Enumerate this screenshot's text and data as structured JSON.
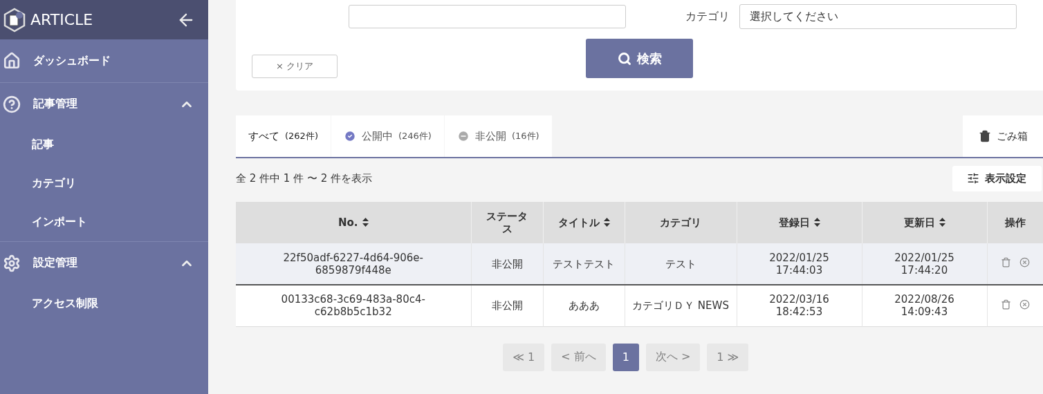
{
  "sidebar": {
    "brand": "ARTICLE",
    "items": [
      {
        "kind": "link",
        "label": "ダッシュボード"
      },
      {
        "kind": "group",
        "label": "記事管理",
        "expanded": true,
        "children": [
          {
            "label": "記事"
          },
          {
            "label": "カテゴリ"
          },
          {
            "label": "インポート"
          }
        ]
      },
      {
        "kind": "group",
        "label": "設定管理",
        "expanded": true,
        "children": [
          {
            "label": "アクセス制限"
          }
        ]
      }
    ]
  },
  "search_panel": {
    "category_label": "カテゴリ",
    "category_placeholder": "選択してください",
    "clear_button": "× クリア",
    "search_button": "検索"
  },
  "tabs": [
    {
      "label": "すべて",
      "count": "(262件)",
      "selected": true
    },
    {
      "label": "公開中",
      "count": "(246件)",
      "selected": false
    },
    {
      "label": "非公開",
      "count": "(16件)",
      "selected": false
    }
  ],
  "trash_button": "ごみ箱",
  "result_summary": "全 2 件中 1 件 〜 2 件を表示",
  "display_settings_button": "表示設定",
  "table": {
    "columns": [
      {
        "label": "No.",
        "sortable": true
      },
      {
        "label": "ステータス",
        "sortable": false
      },
      {
        "label": "タイトル",
        "sortable": true
      },
      {
        "label": "カテゴリ",
        "sortable": false
      },
      {
        "label": "登録日",
        "sortable": true
      },
      {
        "label": "更新日",
        "sortable": true
      },
      {
        "label": "操作",
        "sortable": false
      }
    ],
    "rows": [
      {
        "selected": true,
        "cells": [
          "22f50adf-6227-4d64-906e-6859879f448e",
          "非公開",
          "テストテスト",
          "テスト",
          "2022/01/25 17:44:03",
          "2022/01/25 17:44:20"
        ]
      },
      {
        "selected": false,
        "cells": [
          "00133c68-3c69-483a-80c4-c62b8b5c1b32",
          "非公開",
          "あああ",
          "カテゴリＤＹ NEWS",
          "2022/03/16 18:42:53",
          "2022/08/26 14:09:43"
        ]
      }
    ]
  },
  "pagination": [
    {
      "label": "≪ 1",
      "selected": false,
      "disabled": true
    },
    {
      "label": "< 前へ",
      "selected": false,
      "disabled": true
    },
    {
      "label": "1",
      "selected": true,
      "disabled": false
    },
    {
      "label": "次へ >",
      "selected": false,
      "disabled": true
    },
    {
      "label": "1 ≫",
      "selected": false,
      "disabled": true
    }
  ]
}
